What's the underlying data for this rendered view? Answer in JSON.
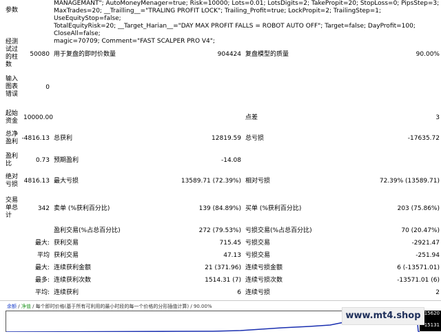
{
  "params": {
    "label": "参数",
    "lines": [
      "MANAGEMANT\"; AutoMoneyMenager=true; Risk=10000; Lots=0.01; LotsDigits=2; TakePropit=20; StopLoss=0; PipsStep=3;",
      "MaxTrades=20; __Trailling__=\"TRALING PROFIT LOCK\"; Trailing_Profit=true; LockPropit=2; TrailingStep=1; UseEquityStop=false;",
      "TotalEquityRisk=20; __Target_Harian__=\"DAY MAX PROFIT FALLS = ROBOT AUTO OFF\"; Target=false; DayProfit=100; CloseAll=false;",
      "magic=70709; Comment=\"FAST SCALPER PRO V4\";"
    ]
  },
  "rows": {
    "bars_label": "经测试过的柱数",
    "bars_value": "50080",
    "ticks_label": "用于复盘的即时价数量",
    "ticks_value": "904424",
    "quality_label": "复盘模型的质量",
    "quality_value": "90.00%",
    "errors_label": "输入图表错误",
    "errors_value": "0",
    "deposit_label": "起始资金",
    "deposit_value": "10000.00",
    "spread_label": "点差",
    "spread_value": "3",
    "net_label": "总净盈利",
    "net_value": "-4816.13",
    "gross_profit_label": "总获利",
    "gross_profit_value": "12819.59",
    "gross_loss_label": "总亏损",
    "gross_loss_value": "-17635.72",
    "pf_label": "盈利比",
    "pf_value": "0.73",
    "payoff_label": "预期盈利",
    "payoff_value": "-14.08",
    "abs_dd_label": "绝对亏损",
    "abs_dd_value": "4816.13",
    "max_dd_label": "最大亏损",
    "max_dd_value": "13589.71 (72.39%)",
    "rel_dd_label": "相对亏损",
    "rel_dd_value": "72.39% (13589.71)",
    "trades_label": "交易单总计",
    "trades_value": "342",
    "short_label": "卖单 (%获利百分比)",
    "short_value": "139 (84.89%)",
    "long_label": "买单 (%获利百分比)",
    "long_value": "203 (75.86%)",
    "profit_trades_label": "盈利交易(%占总百分比)",
    "profit_trades_value": "272 (79.53%)",
    "loss_trades_label": "亏损交易(%占总百分比)",
    "loss_trades_value": "70 (20.47%)",
    "largest_label": "最大:",
    "largest_profit_label": "获利交易",
    "largest_profit_value": "715.45",
    "largest_loss_label": "亏损交易",
    "largest_loss_value": "-2921.47",
    "average_label": "平均",
    "avg_profit_label": "获利交易",
    "avg_profit_value": "47.13",
    "avg_loss_label": "亏损交易",
    "avg_loss_value": "-251.94",
    "max_label": "最大:",
    "max_cons_wins_label": "连续获利金额",
    "max_cons_wins_value": "21 (371.96)",
    "max_cons_losses_label": "连续亏损金额",
    "max_cons_losses_value": "6 (-13571.01)",
    "maximal_label": "最多:",
    "maximal_cons_profit_label": "连续获利次数",
    "maximal_cons_profit_value": "1514.31 (7)",
    "maximal_cons_loss_label": "连续亏损次数",
    "maximal_cons_loss_value": "-13571.01 (6)",
    "avg_cons_label": "平均:",
    "avg_cons_wins_label": "连续获利",
    "avg_cons_wins_value": "6",
    "avg_cons_losses_label": "连续亏损",
    "avg_cons_losses_value": "2"
  },
  "chart": {
    "legend_balance": "余额",
    "legend_equity": "净值",
    "legend_text": "/ 每个即时价格(基于所有可利用的最小时段的每一个价格的分形插值计算) / 90.00%",
    "axis_top": "15620",
    "axis_bottom": "15131",
    "balance_color": "#1a2fb0"
  },
  "watermark": "www.mt4.shop"
}
